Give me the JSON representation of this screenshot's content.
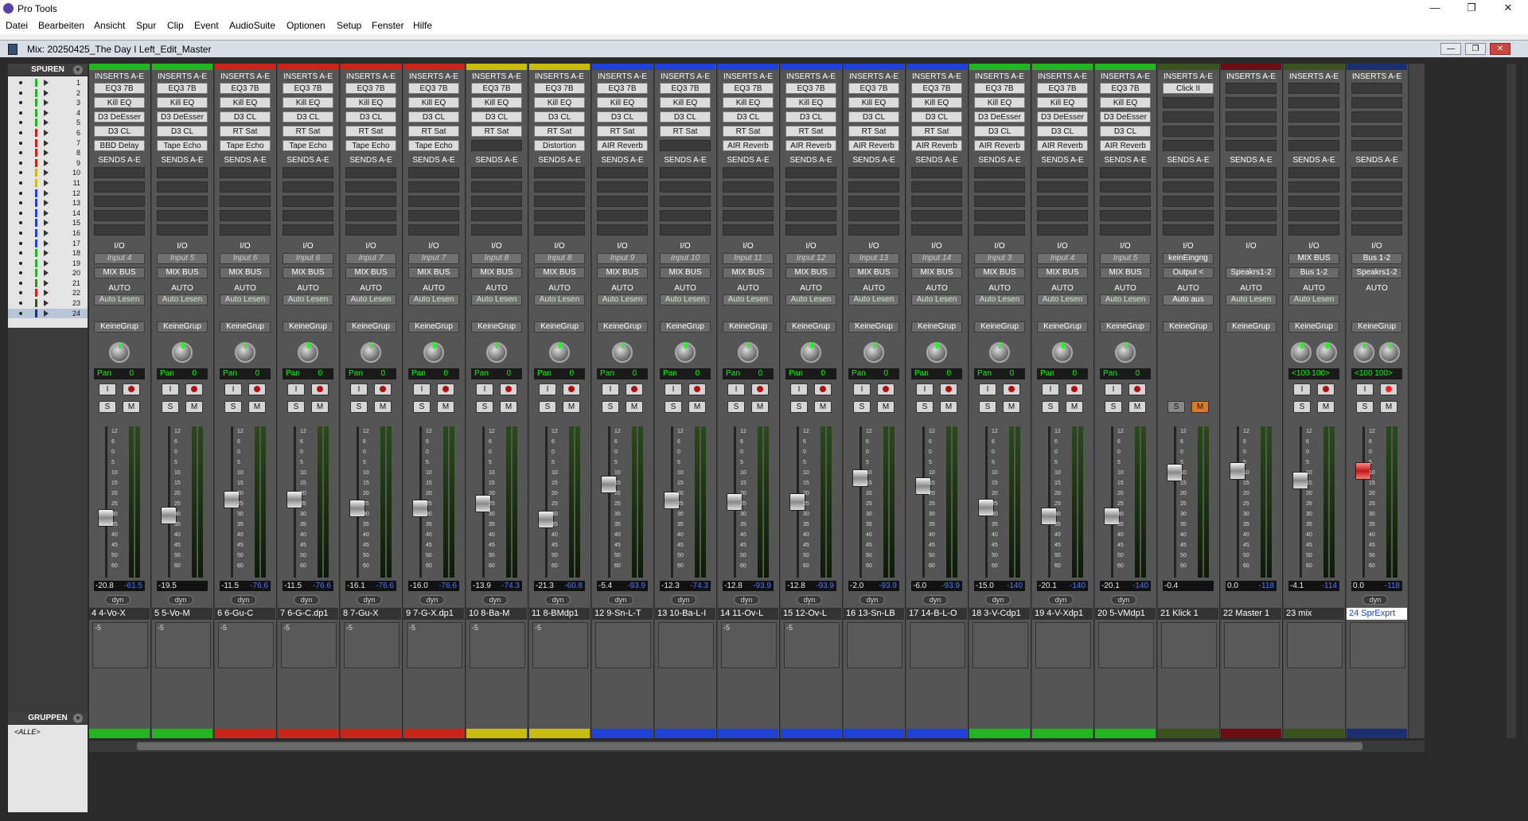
{
  "window": {
    "title": "Pro Tools",
    "min": "—",
    "max": "❐",
    "close": "✕"
  },
  "menu": [
    "Datei",
    "Bearbeiten",
    "Ansicht",
    "Spur",
    "Clip",
    "Event",
    "AudioSuite",
    "Optionen",
    "Setup",
    "Fenster",
    "Hilfe"
  ],
  "doc": {
    "title": "Mix: 20250425_The Day I Left_Edit_Master"
  },
  "sidebar": {
    "tracks_header": "SPUREN",
    "groups_header": "GRUPPEN",
    "group_all": "<ALLE>",
    "tracks": [
      "1",
      "2",
      "3",
      "4",
      "5",
      "6",
      "7",
      "8",
      "9",
      "10",
      "11",
      "12",
      "13",
      "14",
      "15",
      "16",
      "17",
      "18",
      "19",
      "20",
      "21",
      "22",
      "23",
      "24"
    ]
  },
  "labels": {
    "inserts": "INSERTS A-E",
    "sends": "SENDS A-E",
    "io": "I/O",
    "auto": "AUTO",
    "dyn": "dyn",
    "pan": "Pan",
    "solo": "S",
    "mute": "M",
    "input": "I",
    "scale": [
      "12",
      "6",
      "0",
      "5",
      "10",
      "15",
      "20",
      "25",
      "30",
      "35",
      "40",
      "45",
      "50",
      "60"
    ],
    "meter_scale": [
      "0",
      "5",
      "10",
      "15",
      "20",
      "25",
      "30",
      "35",
      "40",
      "45",
      "50",
      "60"
    ],
    "comment_mark": "-5"
  },
  "strips": [
    {
      "name": "4   4-Vo-X",
      "color": "#22b422",
      "inserts": [
        "EQ3 7B",
        "Kill EQ",
        "D3 DeEsser",
        "D3 CL",
        "BBD Delay"
      ],
      "input": "Input 4",
      "output": "MIX BUS",
      "auto": "Auto Lesen",
      "group": "KeineGrup",
      "pan": "0",
      "vol": "-20.8",
      "peak": "-61.5",
      "fader": 0.38,
      "comment": "-5"
    },
    {
      "name": "5   5-Vo-M",
      "color": "#22b422",
      "inserts": [
        "EQ3 7B",
        "Kill EQ",
        "D3 DeEsser",
        "D3 CL",
        "Tape Echo"
      ],
      "input": "Input 5",
      "output": "MIX BUS",
      "auto": "Auto Lesen",
      "group": "KeineGrup",
      "pan": "0",
      "vol": "-19.5",
      "peak": "",
      "fader": 0.4,
      "comment": "-5"
    },
    {
      "name": "6   6-Gu-C",
      "color": "#c8241c",
      "inserts": [
        "EQ3 7B",
        "Kill EQ",
        "D3 CL",
        "RT Sat",
        "Tape Echo"
      ],
      "input": "Input 6",
      "output": "MIX BUS",
      "auto": "Auto Lesen",
      "group": "KeineGrup",
      "pan": "0",
      "vol": "-11.5",
      "peak": "-76.6",
      "fader": 0.52,
      "comment": "-5"
    },
    {
      "name": "7   6-G-C.dp1",
      "color": "#c8241c",
      "inserts": [
        "EQ3 7B",
        "Kill EQ",
        "D3 CL",
        "RT Sat",
        "Tape Echo"
      ],
      "input": "Input 6",
      "output": "MIX BUS",
      "auto": "Auto Lesen",
      "group": "KeineGrup",
      "pan": "0",
      "vol": "-11.5",
      "peak": "-76.6",
      "fader": 0.52,
      "comment": "-5"
    },
    {
      "name": "8   7-Gu-X",
      "color": "#c8241c",
      "inserts": [
        "EQ3 7B",
        "Kill EQ",
        "D3 CL",
        "RT Sat",
        "Tape Echo"
      ],
      "input": "Input 7",
      "output": "MIX BUS",
      "auto": "Auto Lesen",
      "group": "KeineGrup",
      "pan": "0",
      "vol": "-16.1",
      "peak": "-76.6",
      "fader": 0.45,
      "comment": "-5"
    },
    {
      "name": "9   7-G-X.dp1",
      "color": "#c8241c",
      "inserts": [
        "EQ3 7B",
        "Kill EQ",
        "D3 CL",
        "RT Sat",
        "Tape Echo"
      ],
      "input": "Input 7",
      "output": "MIX BUS",
      "auto": "Auto Lesen",
      "group": "KeineGrup",
      "pan": "0",
      "vol": "-16.0",
      "peak": "-76.6",
      "fader": 0.45,
      "comment": "-5"
    },
    {
      "name": "10   8-Ba-M",
      "color": "#c8bc10",
      "inserts": [
        "EQ3 7B",
        "Kill EQ",
        "D3 CL",
        "RT Sat",
        ""
      ],
      "input": "Input 8",
      "output": "MIX BUS",
      "auto": "Auto Lesen",
      "group": "KeineGrup",
      "pan": "0",
      "vol": "-13.9",
      "peak": "-74.3",
      "fader": 0.49,
      "comment": "-5"
    },
    {
      "name": "11   8-BMdp1",
      "color": "#c8bc10",
      "inserts": [
        "EQ3 7B",
        "Kill EQ",
        "D3 CL",
        "RT Sat",
        "Distortion"
      ],
      "input": "Input 8",
      "output": "MIX BUS",
      "auto": "Auto Lesen",
      "group": "KeineGrup",
      "pan": "0",
      "vol": "-21.3",
      "peak": "-60.8",
      "fader": 0.37,
      "comment": "-5"
    },
    {
      "name": "12   9-Sn-L-T",
      "color": "#2040d8",
      "inserts": [
        "EQ3 7B",
        "Kill EQ",
        "D3 CL",
        "RT Sat",
        "AIR Reverb"
      ],
      "input": "Input 9",
      "output": "MIX BUS",
      "auto": "Auto Lesen",
      "group": "KeineGrup",
      "pan": "0",
      "vol": "-5.4",
      "peak": "-93.9",
      "fader": 0.63,
      "comment": ""
    },
    {
      "name": "13   10-Ba-L-I",
      "color": "#2040d8",
      "inserts": [
        "EQ3 7B",
        "Kill EQ",
        "D3 CL",
        "RT Sat",
        ""
      ],
      "input": "Input 10",
      "output": "MIX BUS",
      "auto": "Auto Lesen",
      "group": "KeineGrup",
      "pan": "0",
      "vol": "-12.3",
      "peak": "-74.3",
      "fader": 0.51,
      "comment": ""
    },
    {
      "name": "14   11-Ov-L",
      "color": "#2040d8",
      "inserts": [
        "EQ3 7B",
        "Kill EQ",
        "D3 CL",
        "RT Sat",
        "AIR Reverb"
      ],
      "input": "Input 11",
      "output": "MIX BUS",
      "auto": "Auto Lesen",
      "group": "KeineGrup",
      "pan": "0",
      "vol": "-12.8",
      "peak": "-93.9",
      "fader": 0.5,
      "comment": "-5"
    },
    {
      "name": "15   12-Ov-L",
      "color": "#2040d8",
      "inserts": [
        "EQ3 7B",
        "Kill EQ",
        "D3 CL",
        "RT Sat",
        "AIR Reverb"
      ],
      "input": "Input 12",
      "output": "MIX BUS",
      "auto": "Auto Lesen",
      "group": "KeineGrup",
      "pan": "0",
      "vol": "-12.8",
      "peak": "-93.9",
      "fader": 0.5,
      "comment": "-5"
    },
    {
      "name": "16   13-Sn-LB",
      "color": "#2040d8",
      "inserts": [
        "EQ3 7B",
        "Kill EQ",
        "D3 CL",
        "RT Sat",
        "AIR Reverb"
      ],
      "input": "Input 13",
      "output": "MIX BUS",
      "auto": "Auto Lesen",
      "group": "KeineGrup",
      "pan": "0",
      "vol": "-2.0",
      "peak": "-93.9",
      "fader": 0.68,
      "comment": ""
    },
    {
      "name": "17   14-B-L-O",
      "color": "#2040d8",
      "inserts": [
        "EQ3 7B",
        "Kill EQ",
        "D3 CL",
        "RT Sat",
        "AIR Reverb"
      ],
      "input": "Input 14",
      "output": "MIX BUS",
      "auto": "Auto Lesen",
      "group": "KeineGrup",
      "pan": "0",
      "vol": "-6.0",
      "peak": "-93.9",
      "fader": 0.62,
      "comment": ""
    },
    {
      "name": "18   3-V-Cdp1",
      "color": "#22b422",
      "inserts": [
        "EQ3 7B",
        "Kill EQ",
        "D3 DeEsser",
        "D3 CL",
        "AIR Reverb"
      ],
      "input": "Input 3",
      "output": "MIX BUS",
      "auto": "Auto Lesen",
      "group": "KeineGrup",
      "pan": "0",
      "vol": "-15.0",
      "peak": "-140",
      "fader": 0.46,
      "comment": ""
    },
    {
      "name": "19   4-V-Xdp1",
      "color": "#22b422",
      "inserts": [
        "EQ3 7B",
        "Kill EQ",
        "D3 DeEsser",
        "D3 CL",
        "AIR Reverb"
      ],
      "input": "Input 4",
      "output": "MIX BUS",
      "auto": "Auto Lesen",
      "group": "KeineGrup",
      "pan": "0",
      "vol": "-20.1",
      "peak": "-140",
      "fader": 0.39,
      "comment": ""
    },
    {
      "name": "20   5-VMdp1",
      "color": "#22b422",
      "inserts": [
        "EQ3 7B",
        "Kill EQ",
        "D3 DeEsser",
        "D3 CL",
        "AIR Reverb"
      ],
      "input": "Input 5",
      "output": "MIX BUS",
      "auto": "Auto Lesen",
      "group": "KeineGrup",
      "pan": "0",
      "vol": "-20.1",
      "peak": "-140",
      "fader": 0.39,
      "comment": ""
    },
    {
      "name": "21   Klick 1",
      "color": "#3a5220",
      "inserts": [
        "Click II",
        "",
        "",
        "",
        ""
      ],
      "input": "keinEingng",
      "output": "Output <",
      "auto": "Auto aus",
      "group": "KeineGrup",
      "pan": "",
      "vol": "-0.4",
      "peak": "",
      "fader": 0.72,
      "comment": "",
      "type": "aux"
    },
    {
      "name": "22   Master 1",
      "color": "#6a0e14",
      "inserts": [
        "",
        "",
        "",
        "",
        ""
      ],
      "input": "",
      "output": "Speakrs1-2",
      "auto": "Auto Lesen",
      "group": "KeineGrup",
      "pan": "",
      "vol": "0.0",
      "peak": "-118",
      "fader": 0.73,
      "comment": "",
      "type": "master"
    },
    {
      "name": "23      mix",
      "color": "#3a5220",
      "inserts": [
        "",
        "",
        "",
        "",
        ""
      ],
      "input": "MIX BUS",
      "output": "Bus 1-2",
      "auto": "Auto Lesen",
      "group": "KeineGrup",
      "pan": "<100  100>",
      "vol": "-4.1",
      "peak": "-114",
      "fader": 0.66,
      "comment": "",
      "type": "stereo"
    },
    {
      "name": "24 SprExprt",
      "color": "#1a3070",
      "inserts": [
        "",
        "",
        "",
        "",
        ""
      ],
      "input": "Bus 1-2",
      "output": "Speakrs1-2",
      "auto": "",
      "group": "KeineGrup",
      "pan": "<100  100>",
      "vol": "0.0",
      "peak": "-118",
      "fader": 0.73,
      "comment": "",
      "type": "rec",
      "selected": true
    }
  ]
}
